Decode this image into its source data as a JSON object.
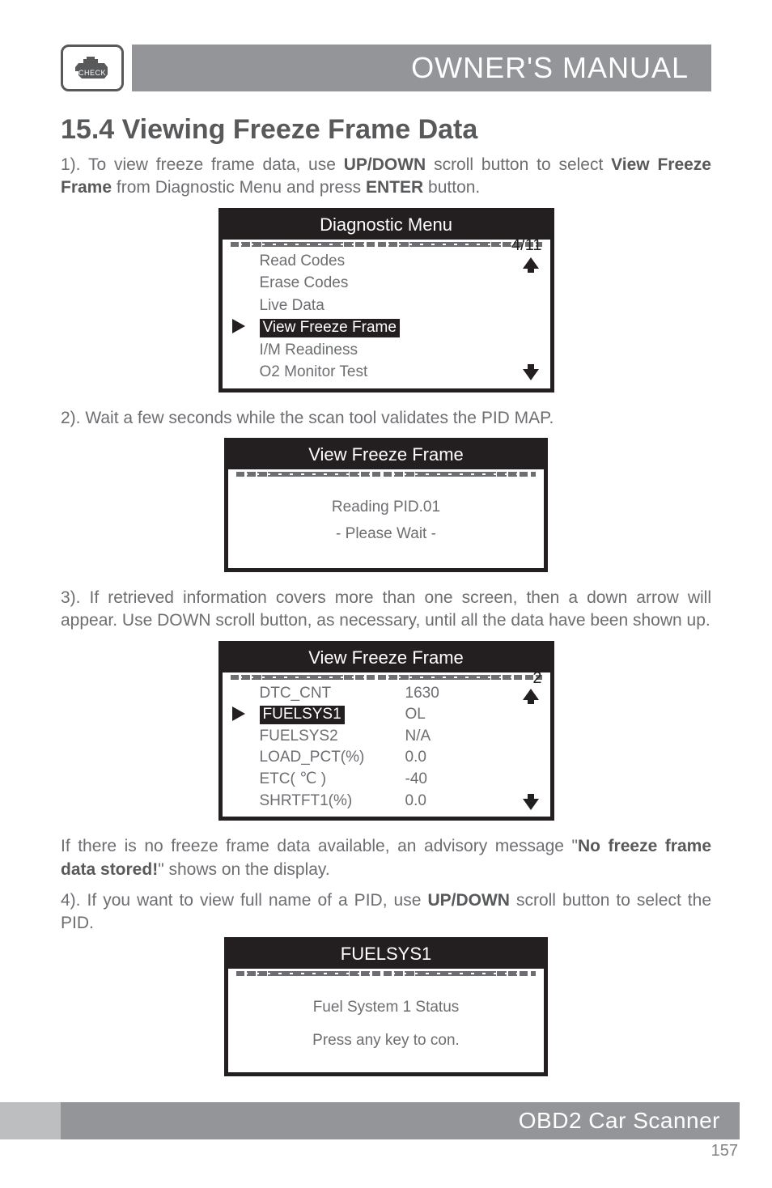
{
  "header": {
    "check_label": "CHECK",
    "manual_title": "OWNER'S MANUAL"
  },
  "section": {
    "heading": "15.4 Viewing Freeze Frame Data",
    "p1_a": "1). To view freeze frame data, use ",
    "p1_b": "UP/DOWN",
    "p1_c": " scroll button to select ",
    "p1_d": "View Freeze Frame",
    "p1_e": " from Diagnostic Menu and press ",
    "p1_f": "ENTER",
    "p1_g": " button.",
    "p2": "2). Wait a few seconds while the scan tool validates the PID MAP.",
    "p3": "3). If retrieved information covers more than one screen, then a down arrow will appear. Use DOWN scroll button, as necessary, until all the data have been shown up.",
    "p4_a": "If there is no freeze frame data available, an advisory message \"",
    "p4_b": "No freeze frame data stored!",
    "p4_c": "\" shows on the display.",
    "p5_a": "4). If you want to view full name of a PID, use ",
    "p5_b": "UP/DOWN",
    "p5_c": " scroll button to select the PID."
  },
  "screens": {
    "diag_menu": {
      "title": "Diagnostic Menu",
      "page": "4/11",
      "items": [
        "Read Codes",
        "Erase Codes",
        "Live Data",
        "View Freeze Frame",
        "I/M Readiness",
        "O2 Monitor Test"
      ],
      "selected_index": 3
    },
    "reading": {
      "title": "View Freeze Frame",
      "line1": "Reading PID.01",
      "line2": "- Please Wait -"
    },
    "freeze_data": {
      "title": "View Freeze Frame",
      "page": "2",
      "rows": [
        {
          "k": "DTC_CNT",
          "v": "1630"
        },
        {
          "k": "FUELSYS1",
          "v": "OL"
        },
        {
          "k": "FUELSYS2",
          "v": "N/A"
        },
        {
          "k": "LOAD_PCT(%)",
          "v": "0.0"
        },
        {
          "k": "ETC( ℃ )",
          "v": "-40"
        },
        {
          "k": "SHRTFT1(%)",
          "v": "0.0"
        }
      ],
      "selected_index": 1
    },
    "pid_detail": {
      "title": "FUELSYS1",
      "line1": "Fuel System 1 Status",
      "line2": "Press any key to con."
    }
  },
  "footer": {
    "product": "OBD2 Car Scanner",
    "page_number": "157"
  }
}
